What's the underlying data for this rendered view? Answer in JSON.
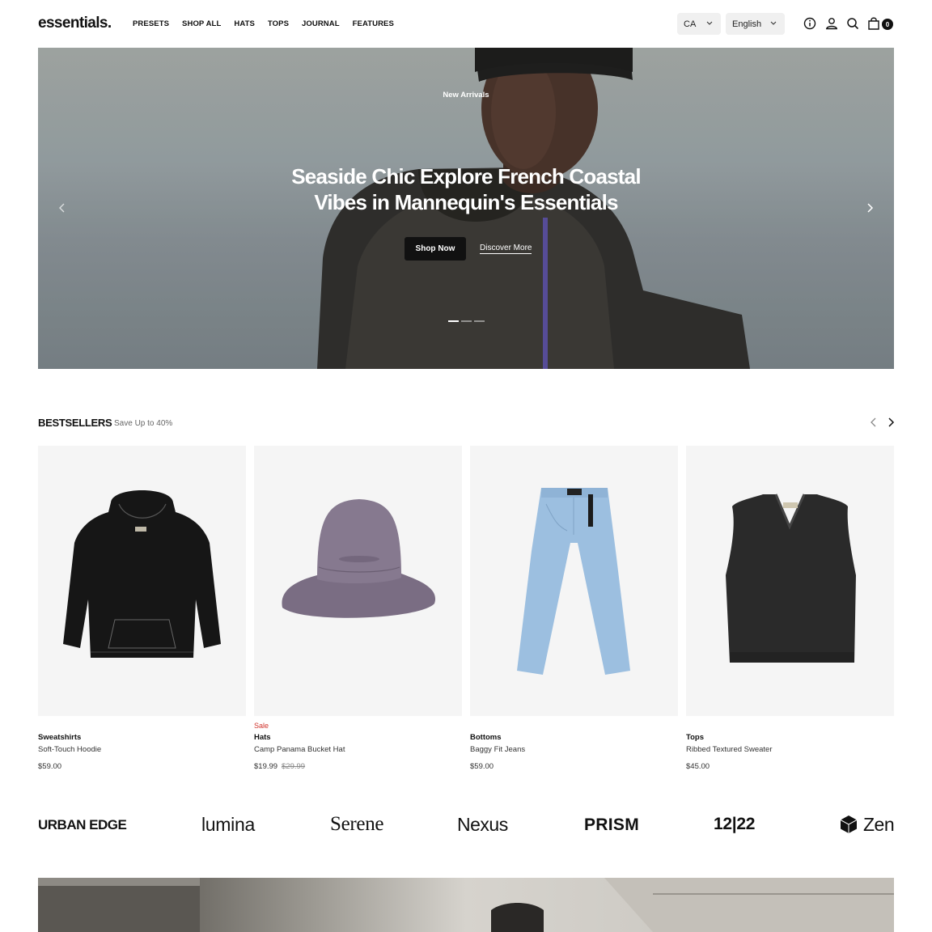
{
  "header": {
    "logo": "essentials.",
    "nav": [
      "PRESETS",
      "SHOP ALL",
      "HATS",
      "TOPS",
      "JOURNAL",
      "FEATURES"
    ],
    "country": "CA",
    "language": "English",
    "cart_count": "0",
    "icons": [
      "info-icon",
      "account-icon",
      "search-icon",
      "cart-icon"
    ]
  },
  "hero": {
    "eyebrow": "New Arrivals",
    "title": "Seaside Chic Explore French Coastal Vibes in Mannequin's Essentials",
    "primary_button": "Shop Now",
    "secondary_link": "Discover More",
    "slides_total": 3,
    "active_slide": 1
  },
  "bestsellers": {
    "title": "BESTSELLERS",
    "subtitle": "Save Up to 40%",
    "products": [
      {
        "category": "Sweatshirts",
        "name": "Soft-Touch Hoodie",
        "price": "$59.00",
        "old_price": "",
        "badge": "",
        "image": "black-hoodie"
      },
      {
        "category": "Hats",
        "name": "Camp Panama Bucket Hat",
        "price": "$19.99",
        "old_price": "$29.99",
        "badge": "Sale",
        "image": "purple-bucket-hat"
      },
      {
        "category": "Bottoms",
        "name": "Baggy Fit Jeans",
        "price": "$59.00",
        "old_price": "",
        "badge": "",
        "image": "light-blue-jeans"
      },
      {
        "category": "Tops",
        "name": "Ribbed Textured Sweater",
        "price": "$45.00",
        "old_price": "",
        "badge": "",
        "image": "black-sweater-vest"
      }
    ]
  },
  "brands": [
    "URBAN EDGE",
    "lumina",
    "Serene",
    "Nexus",
    "PRISM",
    "12|22",
    "Zen"
  ],
  "colors": {
    "accent": "#111111",
    "sale": "#d0322b",
    "card_bg": "#f5f5f5"
  }
}
